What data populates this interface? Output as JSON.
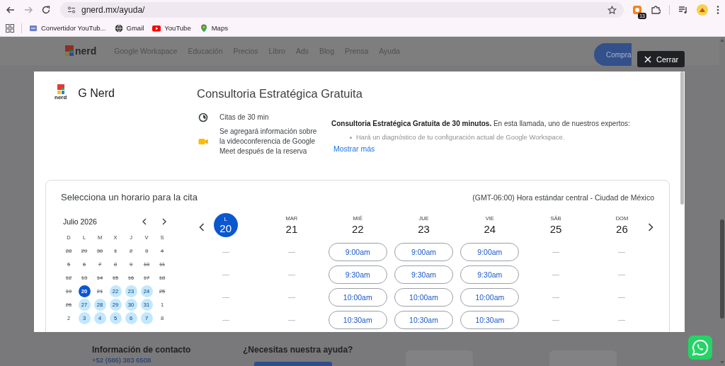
{
  "browser": {
    "url": "gnerd.mx/ayuda/",
    "extension_badge": "13"
  },
  "bookmarks": [
    {
      "label": "Convertidor YouTub..."
    },
    {
      "label": "Gmail"
    },
    {
      "label": "YouTube"
    },
    {
      "label": "Maps"
    }
  ],
  "site_nav": {
    "logo_text": "nerd",
    "links": [
      "Google Workspace",
      "Educación",
      "Precios",
      "Libro",
      "Ads",
      "Blog",
      "Prensa",
      "Ayuda"
    ],
    "cta": "Compra"
  },
  "close_button": "Cerrar",
  "modal": {
    "logo_text": "nerd",
    "organizer": "G Nerd",
    "title": "Consultoria Estratégica Gratuita",
    "details": [
      {
        "kind": "duration",
        "text": "Citas de 30 min"
      },
      {
        "kind": "video",
        "text": "Se agregará información sobre la videoconferencia de Google Meet después de la reserva"
      }
    ],
    "description": "**Consultoria Estratégica Gratuita de 30 minutos.** En esta llamada, uno de nuestros expertos:",
    "bullets": [
      "Hará un diagnóstico de tu configuración actual de Google Workspace."
    ],
    "show_more": "Mostrar más"
  },
  "scheduler": {
    "heading": "Selecciona un horario para la cita",
    "timezone": "(GMT-06:00) Hora estándar central - Ciudad de México",
    "month": "Julio 2026",
    "weekday_initials": [
      "D",
      "L",
      "M",
      "X",
      "J",
      "V",
      "S"
    ],
    "weeks": [
      [
        {
          "day": "28",
          "kind": "past",
          "selected": false
        },
        {
          "day": "29",
          "kind": "past",
          "selected": false
        },
        {
          "day": "30",
          "kind": "past",
          "selected": false
        },
        {
          "day": "1",
          "kind": "past",
          "selected": false
        },
        {
          "day": "2",
          "kind": "past",
          "selected": false
        },
        {
          "day": "3",
          "kind": "past",
          "selected": false
        },
        {
          "day": "4",
          "kind": "past",
          "selected": false
        }
      ],
      [
        {
          "day": "5",
          "kind": "past",
          "selected": false
        },
        {
          "day": "6",
          "kind": "past",
          "selected": false
        },
        {
          "day": "7",
          "kind": "past",
          "selected": false
        },
        {
          "day": "8",
          "kind": "past",
          "selected": false
        },
        {
          "day": "9",
          "kind": "past",
          "selected": false
        },
        {
          "day": "10",
          "kind": "past",
          "selected": false
        },
        {
          "day": "11",
          "kind": "past",
          "selected": false
        }
      ],
      [
        {
          "day": "12",
          "kind": "past",
          "selected": false
        },
        {
          "day": "13",
          "kind": "past",
          "selected": false
        },
        {
          "day": "14",
          "kind": "past",
          "selected": false
        },
        {
          "day": "15",
          "kind": "past",
          "selected": false
        },
        {
          "day": "16",
          "kind": "past",
          "selected": false
        },
        {
          "day": "17",
          "kind": "past",
          "selected": false
        },
        {
          "day": "18",
          "kind": "past",
          "selected": false
        }
      ],
      [
        {
          "day": "19",
          "kind": "past",
          "selected": false
        },
        {
          "day": "20",
          "kind": "available",
          "selected": true
        },
        {
          "day": "21",
          "kind": "past",
          "selected": false
        },
        {
          "day": "22",
          "kind": "available",
          "selected": false
        },
        {
          "day": "23",
          "kind": "available",
          "selected": false
        },
        {
          "day": "24",
          "kind": "available",
          "selected": false
        },
        {
          "day": "25",
          "kind": "past",
          "selected": false
        }
      ],
      [
        {
          "day": "26",
          "kind": "past",
          "selected": false
        },
        {
          "day": "27",
          "kind": "available",
          "selected": false
        },
        {
          "day": "28",
          "kind": "available",
          "selected": false
        },
        {
          "day": "29",
          "kind": "available",
          "selected": false
        },
        {
          "day": "30",
          "kind": "available",
          "selected": false
        },
        {
          "day": "31",
          "kind": "available",
          "selected": false
        },
        {
          "day": "1",
          "kind": "plain",
          "selected": false
        }
      ],
      [
        {
          "day": "2",
          "kind": "plain",
          "selected": false
        },
        {
          "day": "3",
          "kind": "available",
          "selected": false
        },
        {
          "day": "4",
          "kind": "available",
          "selected": false
        },
        {
          "day": "5",
          "kind": "available",
          "selected": false
        },
        {
          "day": "6",
          "kind": "available",
          "selected": false
        },
        {
          "day": "7",
          "kind": "available",
          "selected": false
        },
        {
          "day": "8",
          "kind": "plain",
          "selected": false
        }
      ]
    ],
    "week_days": [
      {
        "weekday": "L",
        "date": "20",
        "selected": true
      },
      {
        "weekday": "MAR",
        "date": "21",
        "selected": false
      },
      {
        "weekday": "MIÉ",
        "date": "22",
        "selected": false,
        "slots": [
          "9:00am",
          "9:30am",
          "10:00am",
          "10:30am"
        ]
      },
      {
        "weekday": "JUE",
        "date": "23",
        "selected": false,
        "slots": [
          "9:00am",
          "9:30am",
          "10:00am",
          "10:30am"
        ]
      },
      {
        "weekday": "VIE",
        "date": "24",
        "selected": false,
        "slots": [
          "9:00am",
          "9:30am",
          "10:00am",
          "10:30am"
        ]
      },
      {
        "weekday": "SÁB",
        "date": "25",
        "selected": false
      },
      {
        "weekday": "DOM",
        "date": "26",
        "selected": false
      }
    ]
  },
  "footer": {
    "contact_heading": "Información de contacto",
    "phone": "+52 (686) 383 6508",
    "help_heading": "¿Necesitas nuestra ayuda?"
  }
}
